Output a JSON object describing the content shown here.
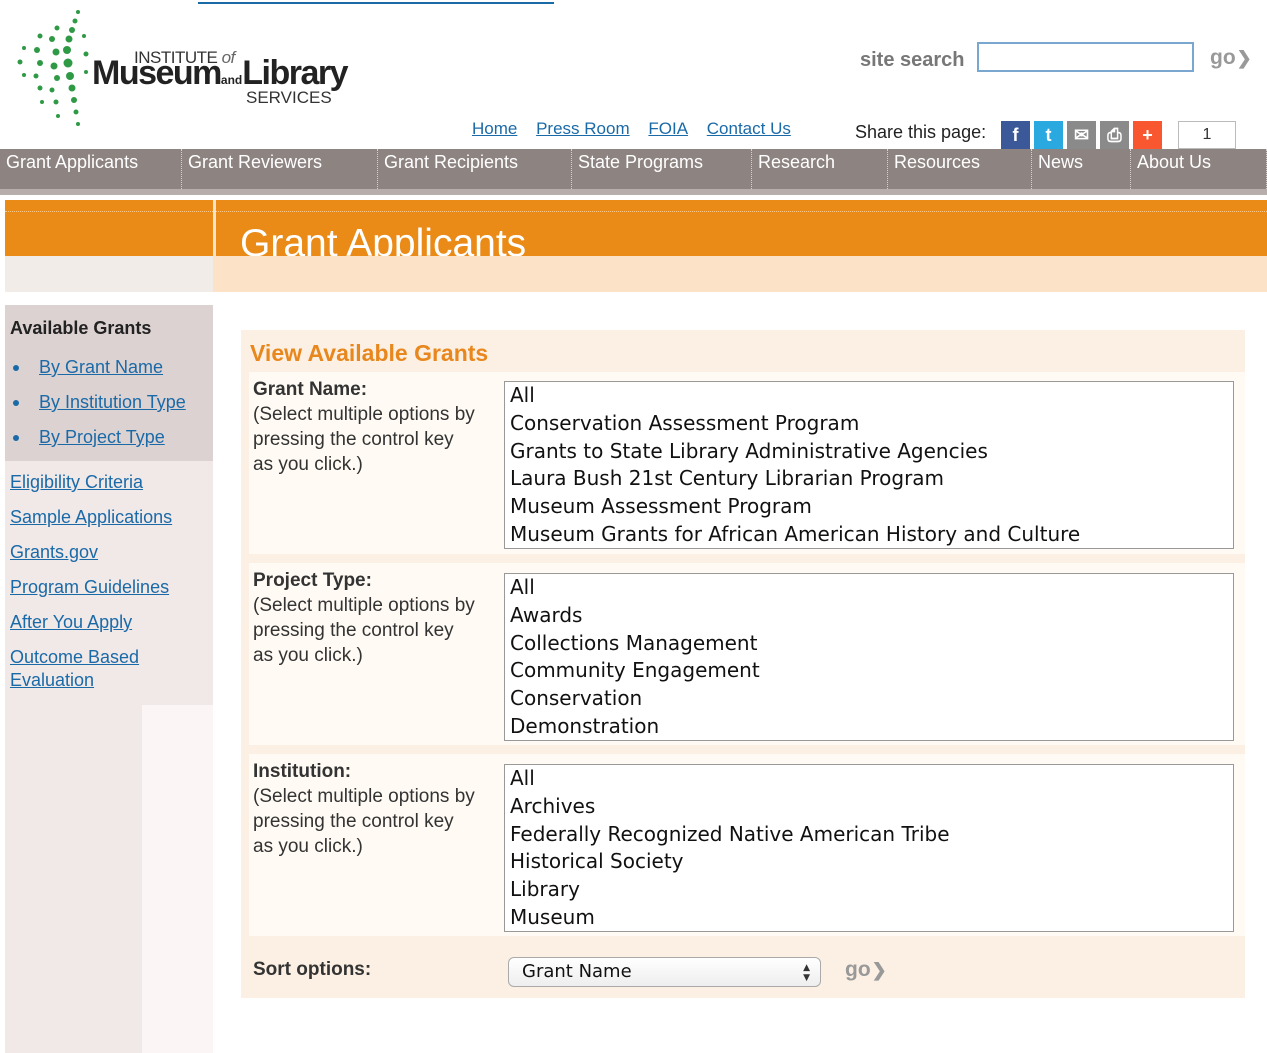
{
  "header": {
    "logo_line1": "INSTITUTE",
    "logo_of": "of",
    "logo_museum": "Museum",
    "logo_and": "and",
    "logo_library": "Library",
    "logo_services": "SERVICES",
    "search_label": "site search",
    "search_value": "",
    "go_label": "go",
    "top_links": [
      "Home",
      "Press Room",
      "FOIA",
      "Contact Us"
    ],
    "share_label": "Share this page:",
    "share_count": "1",
    "share_icons": [
      {
        "name": "facebook-icon",
        "glyph": "f",
        "color": "#3b5998"
      },
      {
        "name": "twitter-icon",
        "glyph": "t",
        "color": "#2aa9e0"
      },
      {
        "name": "email-icon",
        "glyph": "✉",
        "color": "#8a8a8a"
      },
      {
        "name": "print-icon",
        "glyph": "⎙",
        "color": "#8a8a8a"
      },
      {
        "name": "addthis-plus-icon",
        "glyph": "+",
        "color": "#f8572f"
      }
    ]
  },
  "nav": [
    {
      "label": "Grant Applicants",
      "width": 182
    },
    {
      "label": "Grant Reviewers",
      "width": 196
    },
    {
      "label": "Grant Recipients",
      "width": 194
    },
    {
      "label": "State Programs",
      "width": 180
    },
    {
      "label": "Research",
      "width": 136
    },
    {
      "label": "Resources",
      "width": 144
    },
    {
      "label": "News",
      "width": 99
    },
    {
      "label": "About Us",
      "width": 136
    }
  ],
  "banner": {
    "title": "Grant Applicants"
  },
  "sidebar": {
    "title": "Available Grants",
    "bullets": [
      "By Grant Name",
      "By Institution Type",
      "By Project Type"
    ],
    "links": [
      "Eligibility Criteria",
      "Sample Applications",
      "Grants.gov",
      "Program Guidelines",
      "After You Apply",
      "Outcome Based Evaluation"
    ]
  },
  "main": {
    "title": "View Available Grants",
    "hint": "(Select multiple options by pressing the control key as you click.)",
    "grant_name": {
      "label": "Grant Name:",
      "options": [
        "All",
        "Conservation Assessment Program",
        "Grants to State Library Administrative Agencies",
        "Laura Bush 21st Century Librarian Program",
        "Museum Assessment Program",
        "Museum Grants for African American History and Culture"
      ]
    },
    "project_type": {
      "label": "Project Type:",
      "options": [
        "All",
        "Awards",
        "Collections Management",
        "Community Engagement",
        "Conservation",
        "Demonstration"
      ]
    },
    "institution": {
      "label": "Institution:",
      "options": [
        "All",
        "Archives",
        "Federally Recognized Native American Tribe",
        "Historical Society",
        "Library",
        "Museum"
      ]
    },
    "sort": {
      "label": "Sort options:",
      "selected": "Grant Name",
      "go_label": "go"
    }
  }
}
